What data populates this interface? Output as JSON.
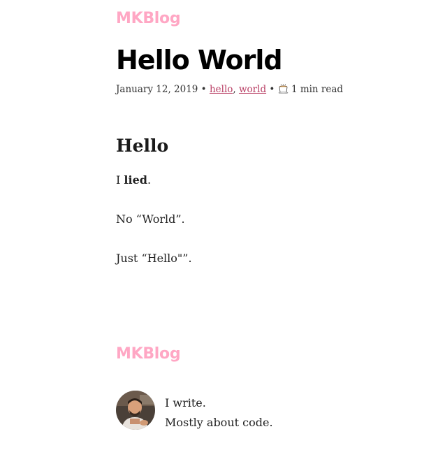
{
  "header": {
    "site_title": "MKBlog"
  },
  "post": {
    "title": "Hello World",
    "date": "January 12, 2019",
    "separator": " • ",
    "tags": [
      "hello",
      "world"
    ],
    "tag_separator": ", ",
    "read_time": "1 min read",
    "read_time_icon": "coffee-cup-icon"
  },
  "content": {
    "heading": "Hello",
    "p1_prefix": "I ",
    "p1_bold": "lied",
    "p1_suffix": ".",
    "p2": "No “World”.",
    "p3": "Just “Hello\"”."
  },
  "footer": {
    "site_title": "MKBlog",
    "bio_line1": "I write.",
    "bio_line2": "Mostly about code.",
    "avatar_icon": "author-avatar"
  },
  "colors": {
    "brand_pink": "#ffa7c4",
    "link": "#b83d63",
    "text": "#222222"
  }
}
